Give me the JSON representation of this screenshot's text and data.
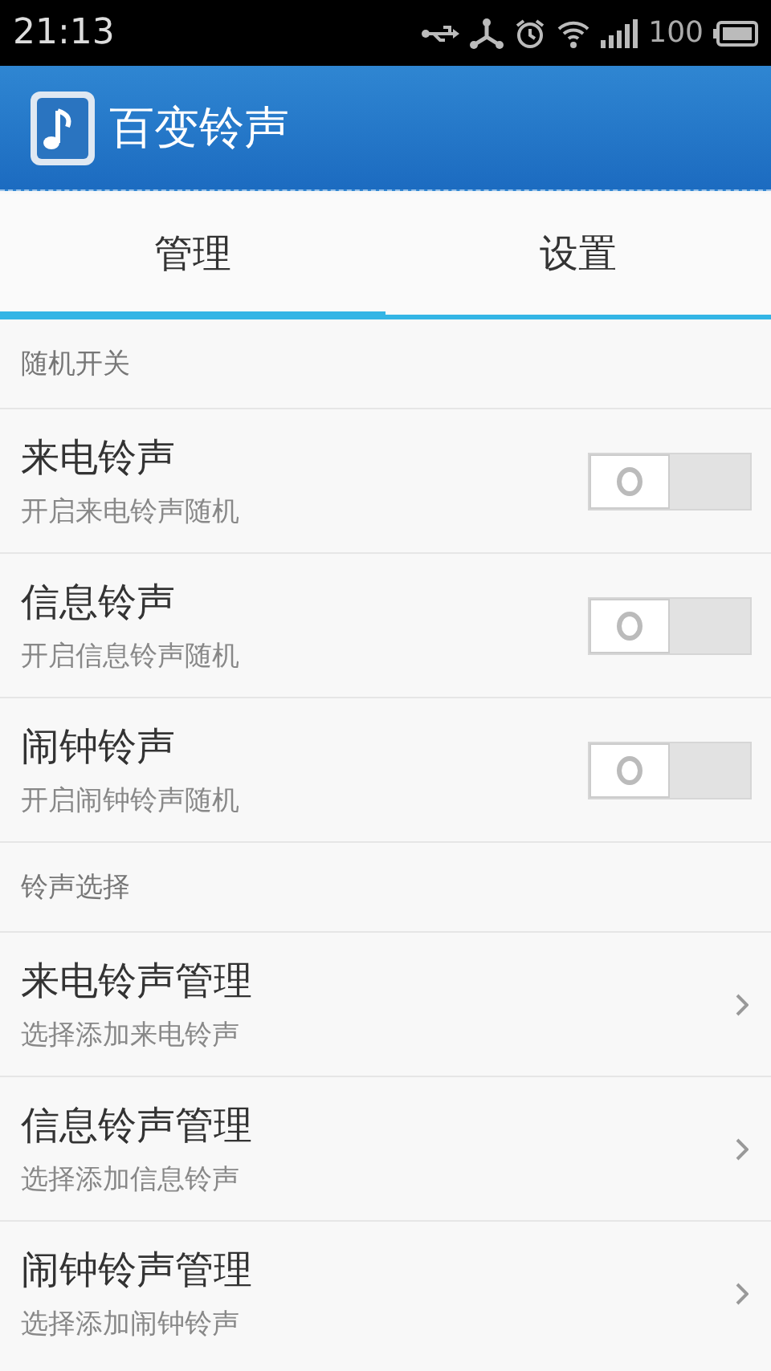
{
  "status_bar": {
    "time": "21:13",
    "battery": "100"
  },
  "app_bar": {
    "title": "百变铃声"
  },
  "tabs": [
    {
      "label": "管理",
      "selected": true
    },
    {
      "label": "设置",
      "selected": false
    }
  ],
  "sections": [
    {
      "header": "随机开关",
      "items": [
        {
          "kind": "toggle",
          "title": "来电铃声",
          "subtitle": "开启来电铃声随机",
          "on": false
        },
        {
          "kind": "toggle",
          "title": "信息铃声",
          "subtitle": "开启信息铃声随机",
          "on": false
        },
        {
          "kind": "toggle",
          "title": "闹钟铃声",
          "subtitle": "开启闹钟铃声随机",
          "on": false
        }
      ]
    },
    {
      "header": "铃声选择",
      "items": [
        {
          "kind": "link",
          "title": "来电铃声管理",
          "subtitle": "选择添加来电铃声"
        },
        {
          "kind": "link",
          "title": "信息铃声管理",
          "subtitle": "选择添加信息铃声"
        },
        {
          "kind": "link",
          "title": "闹钟铃声管理",
          "subtitle": "选择添加闹钟铃声"
        }
      ]
    }
  ]
}
